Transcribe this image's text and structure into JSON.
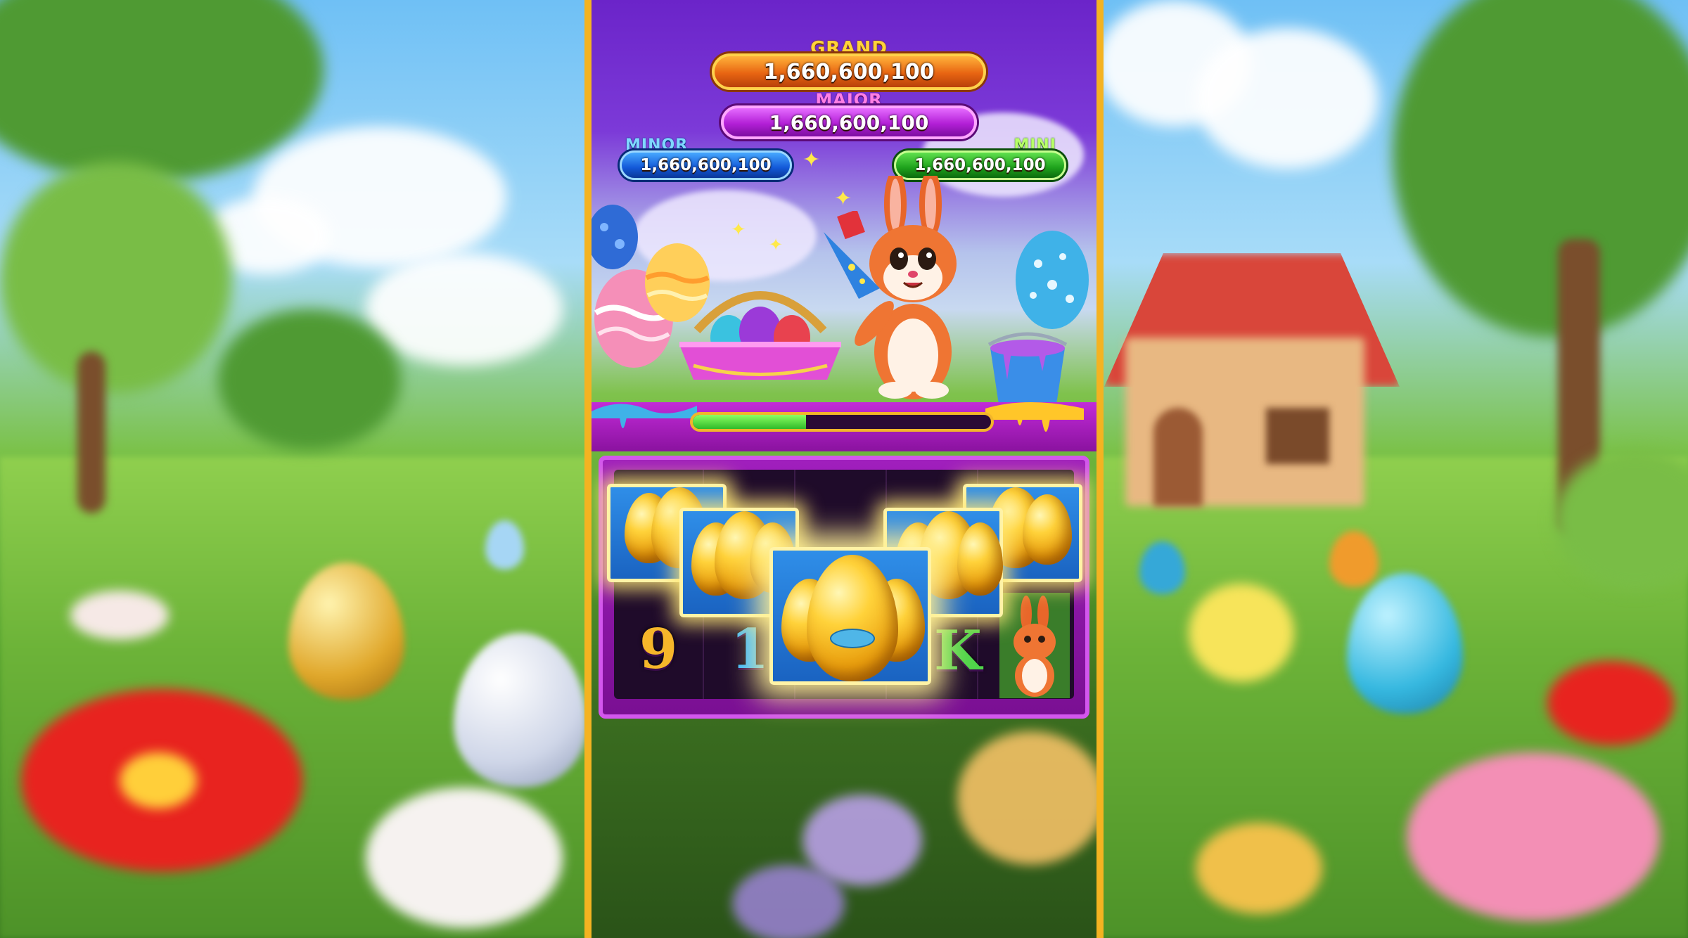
{
  "jackpots": {
    "grand": {
      "label": "GRAND",
      "value": "1,660,600,100"
    },
    "major": {
      "label": "MAJOR",
      "value": "1,660,600,100"
    },
    "minor": {
      "label": "MINOR",
      "value": "1,660,600,100"
    },
    "mini": {
      "label": "MINI",
      "value": "1,660,600,100"
    }
  },
  "progress": {
    "fraction": 0.38
  },
  "reels": {
    "visible_symbols": [
      "9",
      "1",
      "K"
    ],
    "feature_symbol": "golden-egg",
    "feature_tiles": 5
  },
  "colors": {
    "frame_gold": "#f4b321",
    "panel_purple": "#6b24c9",
    "grand": "#e86512",
    "major": "#b21fd6",
    "minor": "#1358d8",
    "mini": "#1ea21c",
    "progress_fill": "#2fbb2a"
  }
}
